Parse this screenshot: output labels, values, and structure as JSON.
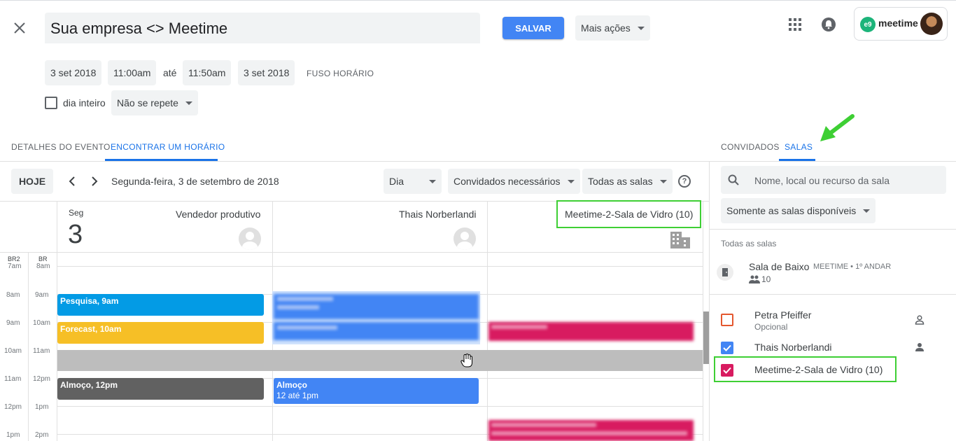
{
  "event": {
    "title": "Sua empresa <> Meetime",
    "save_label": "SALVAR",
    "more_actions_label": "Mais ações",
    "start_date": "3 set 2018",
    "start_time": "11:00am",
    "until_label": "até",
    "end_time": "11:50am",
    "end_date": "3 set 2018",
    "timezone_label": "FUSO HORÁRIO",
    "all_day_label": "dia inteiro",
    "repeat_label": "Não se repete"
  },
  "account": {
    "brand": "meetime"
  },
  "tabs": {
    "details": "DETALHES DO EVENTO",
    "find_time": "ENCONTRAR UM HORÁRIO",
    "guests": "CONVIDADOS",
    "rooms": "SALAS"
  },
  "toolbar": {
    "today": "HOJE",
    "date_label": "Segunda-feira, 3 de setembro de 2018",
    "view": "Dia",
    "guests_filter": "Convidados necessários",
    "rooms_filter": "Todas as salas",
    "help_icon": "?"
  },
  "calendar": {
    "day_abbrev": "Seg",
    "day_number": "3",
    "tz_labels": [
      "BR2",
      "BR"
    ],
    "columns": [
      "Vendedor produtivo",
      "Thais Norberlandi",
      "Meetime-2-Sala de Vidro (10)"
    ],
    "hours_br2": [
      "7am",
      "8am",
      "9am",
      "10am",
      "11am",
      "12pm",
      "1pm"
    ],
    "hours_br": [
      "8am",
      "9am",
      "10am",
      "11am",
      "12pm",
      "1pm",
      "2pm"
    ],
    "events": {
      "pesquisa": "Pesquisa, 9am",
      "forecast": "Forecast, 10am",
      "almoco1": "Almoço, 12pm",
      "almoco2_title": "Almoço",
      "almoco2_time": "12 até 1pm"
    },
    "colors": {
      "blue": "#039be5",
      "yellow": "#f6bf26",
      "gray": "#616161",
      "gcal_blue": "#4285f4",
      "magenta": "#d81b60",
      "selection": "#bdbdbd"
    }
  },
  "rooms_panel": {
    "search_placeholder": "Nome, local ou recurso da sala",
    "availability_filter": "Somente as salas disponíveis",
    "section_label": "Todas as salas",
    "room": {
      "name": "Sala de Baixo",
      "location": "MEETIME • 1º ANDAR",
      "capacity": "10"
    },
    "attendees": [
      {
        "name": "Petra Pfeiffer",
        "sub": "Opcional",
        "color": "#e4572e"
      },
      {
        "name": "Thais Norberlandi",
        "sub": "",
        "color": "#4285f4"
      },
      {
        "name": "Meetime-2-Sala de Vidro (10)",
        "sub": "",
        "color": "#d81b60"
      }
    ]
  }
}
